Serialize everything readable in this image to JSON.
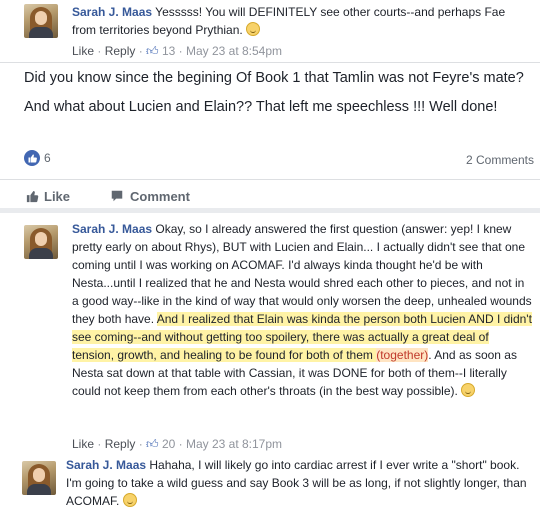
{
  "comment1": {
    "author": "Sarah J. Maas",
    "text": "Yesssss! You will DEFINITELY see other courts--and perhaps Fae from territories beyond Prythian.",
    "like": "Like",
    "reply": "Reply",
    "likes": "13",
    "time": "May 23 at 8:54pm"
  },
  "post": {
    "line1": "Did you know since the begining Of Book 1 that Tamlin was not Feyre's mate?",
    "line2": "And what about Lucien and Elain?? That left me speechless !!! Well done!",
    "like_count": "6",
    "comments_count": "2 Comments",
    "like_action": "Like",
    "comment_action": "Comment"
  },
  "comment2": {
    "author": "Sarah J. Maas",
    "text_a": "Okay, so I already answered the first question (answer: yep! I knew pretty early on about Rhys), BUT with Lucien and Elain... I actually didn't see that one coming until I was working on ACOMAF. I'd always kinda thought he'd be with Nesta...until I realized that he and Nesta would shred each other to pieces, and not in a good way--like in the kind of way that would only worsen the deep, unhealed wounds they both have. ",
    "text_b": "And I realized that Elain was kinda the person both Lucien AND I didn't see coming--and without getting too spoilery, there was actually a great deal of tension, growth, and healing to be found for both of them ",
    "text_c": "(together)",
    "text_d": ". And as soon as Nesta sat down at that table with Cassian, it was DONE for both of them--I literally could not keep them from each other's throats (in the best way possible).",
    "like": "Like",
    "reply": "Reply",
    "likes": "20",
    "time": "May 23 at 8:17pm"
  },
  "comment3": {
    "author": "Sarah J. Maas",
    "text": "Hahaha, I will likely go into cardiac arrest if I ever write a \"short\" book. I'm going to take a wild guess and say Book 3 will be as long, if not slightly longer, than ACOMAF."
  },
  "colors": {
    "name": "#365899",
    "meta": "#90949c",
    "highlight": "#fff3a6",
    "link_blue": "#4267b2"
  }
}
